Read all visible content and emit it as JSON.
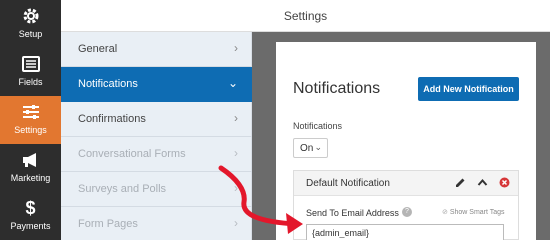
{
  "header": {
    "title": "Settings"
  },
  "rail": [
    {
      "label": "Setup",
      "icon": "gear-icon"
    },
    {
      "label": "Fields",
      "icon": "list-icon"
    },
    {
      "label": "Settings",
      "icon": "sliders-icon",
      "active": true
    },
    {
      "label": "Marketing",
      "icon": "megaphone-icon"
    },
    {
      "label": "Payments",
      "icon": "dollar-icon"
    }
  ],
  "subnav": [
    {
      "label": "General",
      "chevron": "›"
    },
    {
      "label": "Notifications",
      "chevron": "⌄",
      "active": true
    },
    {
      "label": "Confirmations",
      "chevron": "›"
    },
    {
      "label": "Conversational Forms",
      "chevron": "›",
      "disabled": true
    },
    {
      "label": "Surveys and Polls",
      "chevron": "›",
      "disabled": true
    },
    {
      "label": "Form Pages",
      "chevron": "›",
      "disabled": true
    }
  ],
  "panel": {
    "title": "Notifications",
    "add_button": "Add New Notification",
    "notifications_label": "Notifications",
    "notifications_select": {
      "value": "On",
      "caret": "⌄"
    },
    "default_notification": {
      "title": "Default Notification",
      "email_label": "Send To Email Address",
      "help_glyph": "?",
      "smart_tags_icon": "⊘",
      "smart_tags_link": "Show Smart Tags",
      "email_value": "{admin_email}"
    }
  },
  "colors": {
    "accent": "#0e6cb3",
    "active_rail": "#e27730",
    "annotation_arrow": "#e3172b",
    "rail_bg": "#2d2d2d"
  }
}
